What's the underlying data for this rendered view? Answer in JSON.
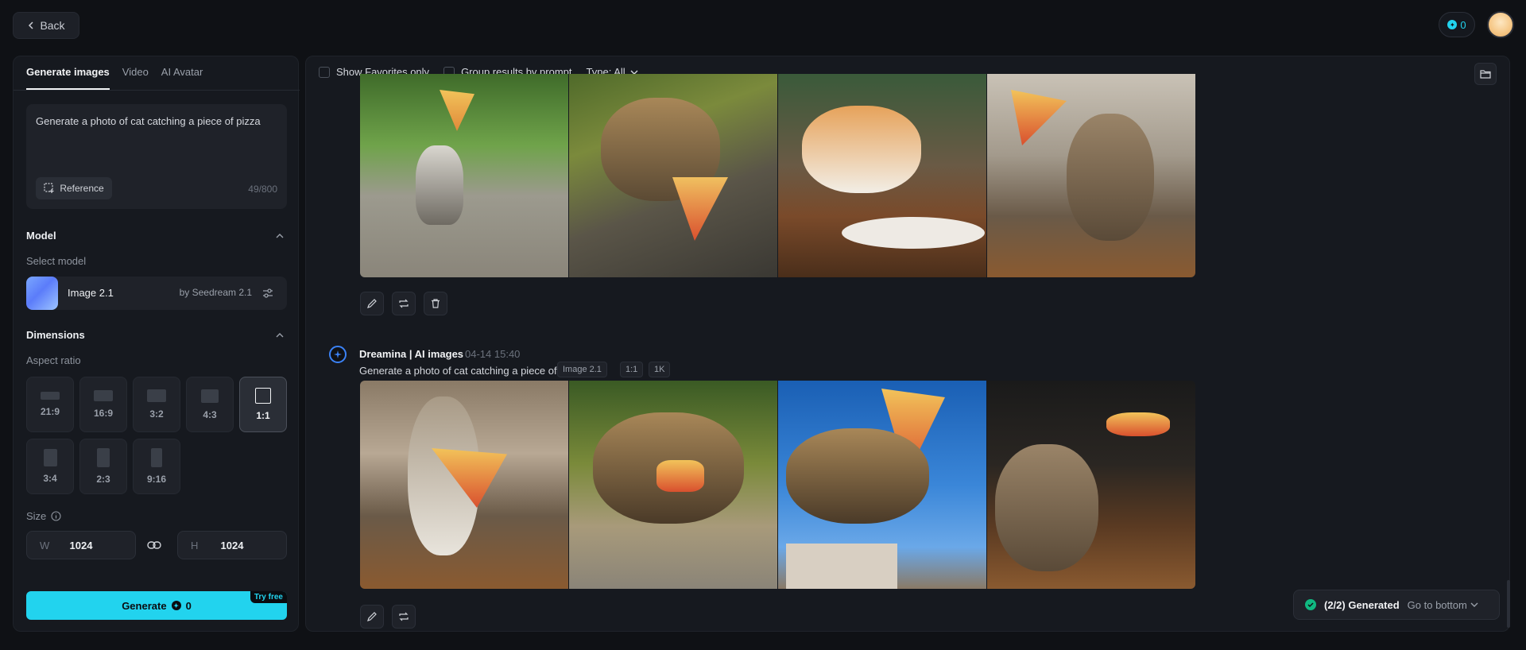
{
  "nav": {
    "back_label": "Back",
    "credits": "0"
  },
  "left_panel": {
    "tabs": [
      "Generate images",
      "Video",
      "AI Avatar"
    ],
    "prompt": {
      "text": "Generate a photo of cat catching a piece of pizza",
      "reference_label": "Reference",
      "char_count": "49/800"
    },
    "model": {
      "section_title": "Model",
      "select_label": "Select model",
      "name": "Image 2.1",
      "by": "by Seedream 2.1"
    },
    "dimensions": {
      "section_title": "Dimensions",
      "aspect_label": "Aspect ratio",
      "ratios": [
        "21:9",
        "16:9",
        "3:2",
        "4:3",
        "1:1",
        "3:4",
        "2:3",
        "9:16"
      ],
      "selected": "1:1",
      "size_label": "Size",
      "width_label": "W",
      "width": "1024",
      "height_label": "H",
      "height": "1024"
    },
    "generate": {
      "label": "Generate",
      "cost": "0",
      "badge": "Try free"
    }
  },
  "main": {
    "filters": {
      "favorites": "Show Favorites only",
      "group": "Group results by prompt",
      "type": "Type: All"
    },
    "generation": {
      "author": "Dreamina | AI images",
      "date": "04-14",
      "time": "15:40",
      "prompt": "Generate a photo of cat catching a piece of pizza",
      "tags": [
        "Image 2.1",
        "1:1",
        "1K"
      ]
    },
    "toast": {
      "status": "(2/2) Generated",
      "action": "Go to bottom"
    }
  },
  "colors": {
    "accent": "#22d3ee",
    "background": "#0f1115",
    "panel": "#16191f",
    "success": "#10b981"
  }
}
